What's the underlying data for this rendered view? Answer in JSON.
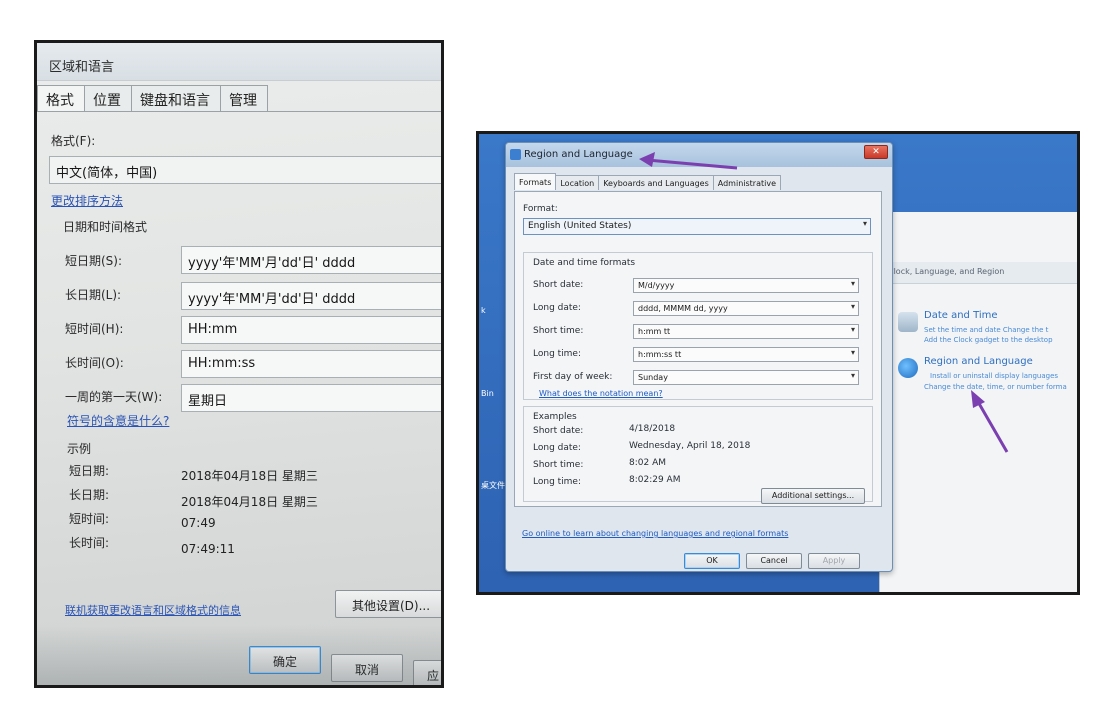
{
  "left_photo": {
    "title": "区域和语言",
    "tabs": [
      "格式",
      "位置",
      "键盘和语言",
      "管理"
    ],
    "format_label": "格式(F):",
    "format_value": "中文(简体，中国)",
    "change_sort_link": "更改排序方法",
    "datetime_section": "日期和时间格式",
    "fields": [
      {
        "label": "短日期(S):",
        "value": "yyyy'年'MM'月'dd'日' dddd"
      },
      {
        "label": "长日期(L):",
        "value": "yyyy'年'MM'月'dd'日' dddd"
      },
      {
        "label": "短时间(H):",
        "value": "HH:mm"
      },
      {
        "label": "长时间(O):",
        "value": "HH:mm:ss"
      },
      {
        "label": "一周的第一天(W):",
        "value": "星期日"
      }
    ],
    "notation_link": "符号的含意是什么?",
    "examples_label": "示例",
    "examples": [
      {
        "label": "短日期:",
        "value": "2018年04月18日 星期三"
      },
      {
        "label": "长日期:",
        "value": "2018年04月18日 星期三"
      },
      {
        "label": "短时间:",
        "value": "07:49"
      },
      {
        "label": "长时间:",
        "value": "07:49:11"
      }
    ],
    "online_link": "联机获取更改语言和区域格式的信息",
    "additional_button": "其他设置(D)...",
    "ok_button": "确定",
    "cancel_button": "取消",
    "apply_button": "应"
  },
  "right_photo": {
    "title": "Region and Language",
    "close_glyph": "✕",
    "tabs": [
      "Formats",
      "Location",
      "Keyboards and Languages",
      "Administrative"
    ],
    "format_label": "Format:",
    "format_value": "English (United States)",
    "dropdown_glyph": "▾",
    "datetime_section": "Date and time formats",
    "fields": [
      {
        "label": "Short date:",
        "value": "M/d/yyyy"
      },
      {
        "label": "Long date:",
        "value": "dddd, MMMM dd, yyyy"
      },
      {
        "label": "Short time:",
        "value": "h:mm tt"
      },
      {
        "label": "Long time:",
        "value": "h:mm:ss tt"
      },
      {
        "label": "First day of week:",
        "value": "Sunday"
      }
    ],
    "notation_link": "What does the notation mean?",
    "examples_label": "Examples",
    "examples": [
      {
        "label": "Short date:",
        "value": "4/18/2018"
      },
      {
        "label": "Long date:",
        "value": "Wednesday, April 18, 2018"
      },
      {
        "label": "Short time:",
        "value": "8:02 AM"
      },
      {
        "label": "Long time:",
        "value": "8:02:29 AM"
      }
    ],
    "additional_button": "Additional settings...",
    "online_link": "Go online to learn about changing languages and regional formats",
    "ok_button": "OK",
    "cancel_button": "Cancel",
    "apply_button": "Apply",
    "control_panel": {
      "breadcrumb": "Clock, Language, and Region",
      "date_time_title": "Date and Time",
      "date_time_links": "Set the time and date    Change the t",
      "date_time_links2": "Add the Clock gadget to the desktop",
      "region_title": "Region and Language",
      "region_links": "Install or uninstall display languages",
      "region_links2": "Change the date, time, or number forma"
    },
    "desktop_labels": [
      "Bin",
      "桌文件",
      "k",
      "t"
    ],
    "arrow_color": "#7b3fb0"
  }
}
